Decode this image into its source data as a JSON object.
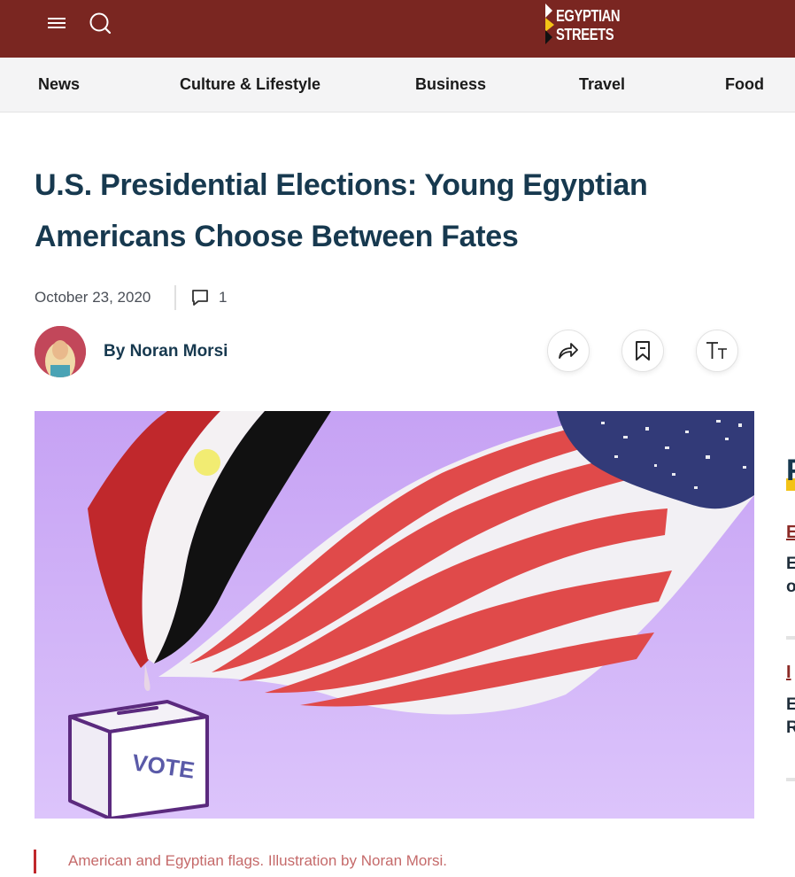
{
  "brand": {
    "logo_line1": "EGYPTIAN",
    "logo_line2": "STREETS",
    "header_color": "#7a2621"
  },
  "header": {
    "menu_icon": "hamburger-menu-icon",
    "search_icon": "search-icon"
  },
  "nav": {
    "items": [
      {
        "label": "News"
      },
      {
        "label": "Culture & Lifestyle"
      },
      {
        "label": "Business"
      },
      {
        "label": "Travel"
      },
      {
        "label": "Food"
      }
    ]
  },
  "article": {
    "title": "U.S. Presidential Elections: Young Egyptian Americans Choose Between Fates",
    "date": "October 23, 2020",
    "comment_count": "1",
    "byline_prefix": "By",
    "author": "Noran Morsi",
    "actions": [
      {
        "name": "share-icon"
      },
      {
        "name": "bookmark-icon"
      },
      {
        "name": "text-size-icon"
      }
    ],
    "hero_image": {
      "ballot_text": "VOTE"
    },
    "caption": "American and Egyptian flags. Illustration by Noran Morsi."
  },
  "sidebar": {
    "heading_letter": "P",
    "items": [
      {
        "link": "E",
        "text_line1": "E",
        "text_line2": "o"
      },
      {
        "link": "I",
        "text_line1": "E",
        "text_line2": "R"
      }
    ]
  },
  "colors": {
    "accent": "#c0282c",
    "title": "#17394f",
    "hero_background": "#c9a6f5"
  }
}
